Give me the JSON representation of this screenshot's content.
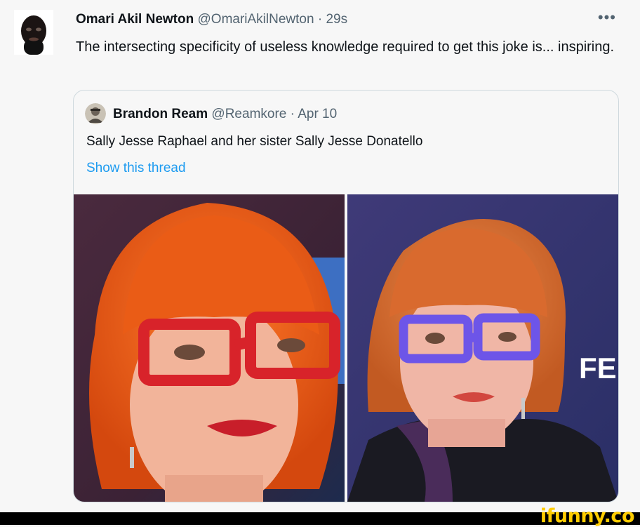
{
  "tweet": {
    "author_name": "Omari Akil Newton",
    "author_handle": "@OmariAkilNewton",
    "separator": "·",
    "time": "29s",
    "more_icon": "more-horizontal-icon",
    "text": "The intersecting specificity of useless knowledge required to get this joke is... inspiring."
  },
  "quoted_tweet": {
    "author_name": "Brandon Ream",
    "author_handle": "@Reamkore",
    "separator": "·",
    "date": "Apr 10",
    "text": "Sally Jesse Raphael and her sister Sally Jesse Donatello",
    "show_thread": "Show this thread",
    "photo_right_sign_text": "FE"
  },
  "watermark": {
    "text": "ifunny.co"
  },
  "colors": {
    "link": "#1d9bf0",
    "muted": "#536471",
    "glasses_left": "#d8232a",
    "glasses_right": "#6d55e8"
  }
}
